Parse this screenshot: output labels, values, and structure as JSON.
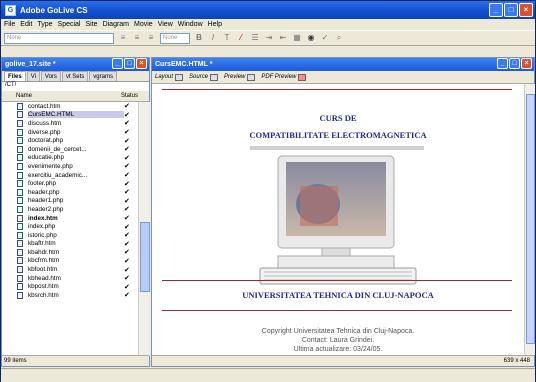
{
  "window": {
    "title": "Adobe GoLive CS"
  },
  "menu": [
    "File",
    "Edit",
    "Type",
    "Special",
    "Site",
    "Diagram",
    "Movie",
    "View",
    "Window",
    "Help"
  ],
  "toolbar": {
    "field1": "None",
    "field2": "None"
  },
  "site_panel": {
    "title": "golive_17.site *",
    "tabs": [
      "Files",
      "Vi",
      "Vors",
      "vt Sets",
      "vgrams"
    ],
    "path": "/CT/",
    "col_name": "Name",
    "col_status": "Status",
    "files": [
      {
        "name": "contact.htm",
        "type": "htm"
      },
      {
        "name": "CursEMC.HTML",
        "type": "htm",
        "selected": true
      },
      {
        "name": "discuss.htm",
        "type": "htm"
      },
      {
        "name": "diverse.php",
        "type": "php"
      },
      {
        "name": "doctorat.php",
        "type": "php"
      },
      {
        "name": "domenii_de_cercet...",
        "type": "php"
      },
      {
        "name": "educatie.php",
        "type": "php"
      },
      {
        "name": "evenimente.php",
        "type": "php"
      },
      {
        "name": "exercitiu_academic...",
        "type": "php"
      },
      {
        "name": "footer.php",
        "type": "php"
      },
      {
        "name": "header.php",
        "type": "php"
      },
      {
        "name": "header1.php",
        "type": "php"
      },
      {
        "name": "header2.php",
        "type": "php"
      },
      {
        "name": "index.htm",
        "type": "htm",
        "bold": true
      },
      {
        "name": "index.php",
        "type": "php"
      },
      {
        "name": "istoric.php",
        "type": "php"
      },
      {
        "name": "kbaftr.htm",
        "type": "htm"
      },
      {
        "name": "kbahdr.htm",
        "type": "htm"
      },
      {
        "name": "kbcfrm.htm",
        "type": "htm"
      },
      {
        "name": "kbfoot.htm",
        "type": "htm"
      },
      {
        "name": "kbhead.htm",
        "type": "htm"
      },
      {
        "name": "kbpost.htm",
        "type": "htm"
      },
      {
        "name": "kbsrch.htm",
        "type": "htm"
      }
    ],
    "status_check": "✔",
    "status_bar": "99 items"
  },
  "doc": {
    "title": "CursEMC.HTML *",
    "tabs": [
      "Layout",
      "Source",
      "Preview",
      "PDF Preview"
    ],
    "heading1": "CURS DE",
    "heading2": "COMPATIBILITATE ELECTROMAGNETICA",
    "university": "UNIVERSITATEA TEHNICA DIN CLUJ-NAPOCA",
    "copyright": "Copyright Universitatea Tehnica din Cluj-Napoca.",
    "contact": "Contact: Laura Grindei.",
    "updated": "Ultima actualizare: 03/24/05.",
    "status_size": "639 x 448"
  },
  "colors": {
    "accent": "#1150d0",
    "heading": "#1e2a8a",
    "rule": "#9a2a2a"
  }
}
